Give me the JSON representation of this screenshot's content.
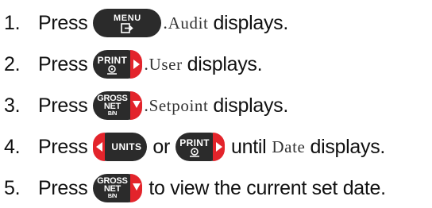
{
  "steps": [
    {
      "num": "1.",
      "press": "Press",
      "key": "MENU",
      "display": "Audit",
      "after": "displays."
    },
    {
      "num": "2.",
      "press": "Press",
      "key": "PRINT",
      "display": "User",
      "after": "displays."
    },
    {
      "num": "3.",
      "press": "Press",
      "key": "GROSS",
      "key2": "NET",
      "key3": "B/N",
      "display": "Setpoint",
      "after": "displays."
    },
    {
      "num": "4.",
      "press": "Press",
      "key": "UNITS",
      "or": "or",
      "key_b": "PRINT",
      "until": "until",
      "display": "Date",
      "after": "displays."
    },
    {
      "num": "5.",
      "press": "Press",
      "key": "GROSS",
      "key2": "NET",
      "key3": "B/N",
      "after": "to view the current set date."
    }
  ],
  "icons": {
    "menu": "exit-arrow-icon",
    "print": "print-target-icon",
    "gross": "down-arrow-icon",
    "units": "left-arrow-icon",
    "print_right": "right-arrow-icon"
  },
  "colors": {
    "key_body": "#2b2b2b",
    "key_accent": "#e3242b",
    "text": "#111111"
  }
}
